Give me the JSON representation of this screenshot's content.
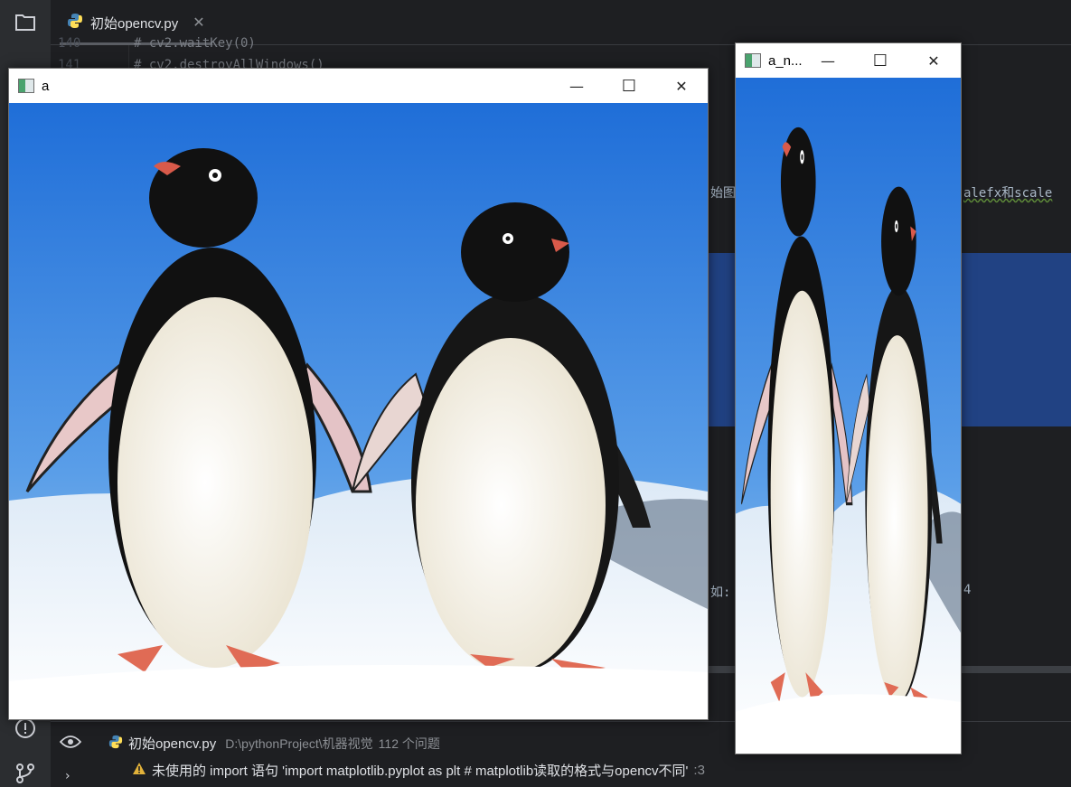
{
  "editor": {
    "tab_label": "初始opencv.py",
    "tab_close": "✕",
    "line_numbers": [
      "140",
      "141"
    ],
    "code_lines": [
      "# cv2.waitKey(0)",
      "# cv2.destroyAllWindows()"
    ],
    "snippet_a": "始图",
    "snippet_b": "alefx和scale",
    "snippet_c": "如:",
    "snippet_d": "4"
  },
  "windows": [
    {
      "title": "a",
      "minimize": "—",
      "maximize": "☐",
      "close": "✕"
    },
    {
      "title": "a_n...",
      "minimize": "—",
      "maximize": "☐",
      "close": "✕"
    }
  ],
  "problems": {
    "file_name": "初始opencv.py",
    "path": "D:\\pythonProject\\机器视觉",
    "count": "112 个问题",
    "warning_text": "未使用的 import 语句 'import matplotlib.pyplot as plt # matplotlib读取的格式与opencv不同'",
    "warning_line": ":3"
  },
  "colors": {
    "ide_bg": "#1e1f22",
    "selection": "#214283",
    "sky": "#2f7fe0",
    "snow": "#f4f7fb"
  }
}
